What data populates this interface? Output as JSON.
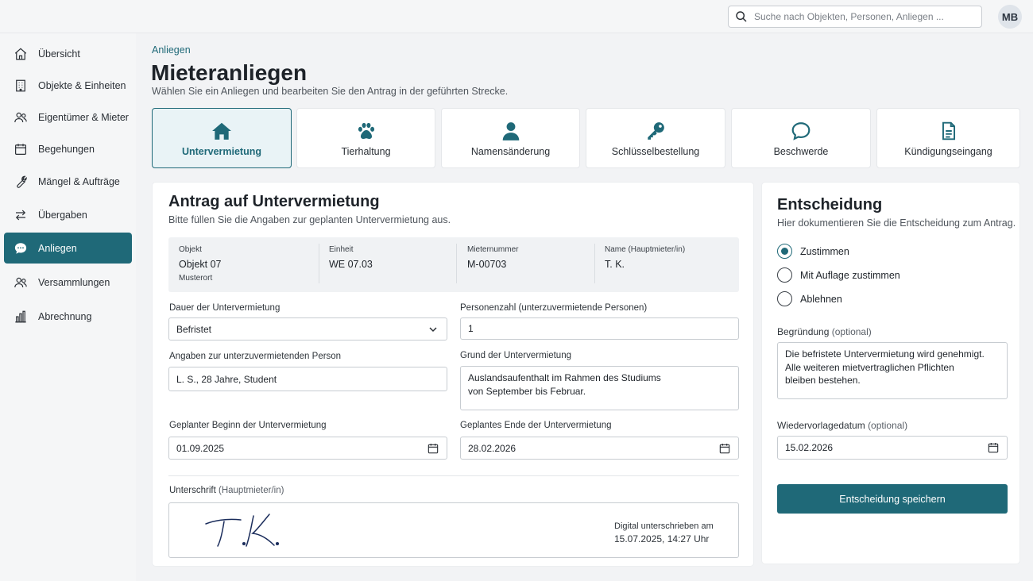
{
  "search": {
    "placeholder": "Suche nach Objekten, Personen, Anliegen ..."
  },
  "user": {
    "initials": "MB"
  },
  "sidebar": {
    "items": [
      {
        "label": "Übersicht",
        "icon": "home-icon"
      },
      {
        "label": "Objekte & Einheiten",
        "icon": "building-icon"
      },
      {
        "label": "Eigentümer & Mieter",
        "icon": "users-icon"
      },
      {
        "label": "Begehungen",
        "icon": "calendar-icon"
      },
      {
        "label": "Mängel & Aufträge",
        "icon": "wrench-icon"
      },
      {
        "label": "Übergaben",
        "icon": "swap-icon"
      },
      {
        "label": "Anliegen",
        "icon": "chat-icon",
        "active": true
      },
      {
        "label": "Versammlungen",
        "icon": "users-icon"
      },
      {
        "label": "Abrechnung",
        "icon": "bar-chart-icon"
      }
    ]
  },
  "header": {
    "breadcrumb": "Anliegen",
    "title": "Mieteranliegen",
    "subtitle": "Wählen Sie ein Anliegen und bearbeiten Sie den Antrag in der geführten Strecke."
  },
  "types": [
    {
      "label": "Untervermietung",
      "icon": "house-icon",
      "active": true
    },
    {
      "label": "Tierhaltung",
      "icon": "paw-icon"
    },
    {
      "label": "Namensänderung",
      "icon": "person-icon"
    },
    {
      "label": "Schlüsselbestellung",
      "icon": "key-icon"
    },
    {
      "label": "Beschwerde",
      "icon": "speech-bubble-icon"
    },
    {
      "label": "Kündigungseingang",
      "icon": "document-icon"
    }
  ],
  "form": {
    "title": "Antrag auf Untervermietung",
    "subtitle": "Bitte füllen Sie die Angaben zur geplanten Untervermietung aus.",
    "info": {
      "objekt_label": "Objekt",
      "objekt_value": "Objekt 07",
      "objekt_sub": "Musterort",
      "einheit_label": "Einheit",
      "einheit_value": "WE 07.03",
      "mieternummer_label": "Mieternummer",
      "mieternummer_value": "M-00703",
      "name_label": "Name (Hauptmieter/in)",
      "name_value": "T. K."
    },
    "dauer_label": "Dauer der Untervermietung",
    "dauer_value": "Befristet",
    "personen_label": "Personenzahl (unterzuvermietende Personen)",
    "personen_value": "1",
    "angaben_label": "Angaben zur unterzuvermietenden Person",
    "angaben_value": "L. S., 28 Jahre, Student",
    "grund_label": "Grund der Untervermietung",
    "grund_value": "Auslandsaufenthalt im Rahmen des Studiums\nvon September bis Februar.",
    "beginn_label": "Geplanter Beginn der Untervermietung",
    "beginn_value": "01.09.2025",
    "ende_label": "Geplantes Ende der Untervermietung",
    "ende_value": "28.02.2026",
    "unterschrift_label": "Unterschrift",
    "unterschrift_suffix": "(Hauptmieter/in)",
    "signature_line1": "Digital unterschrieben am",
    "signature_line2": "15.07.2025, 14:27 Uhr"
  },
  "decision": {
    "title": "Entscheidung",
    "subtitle": "Hier dokumentieren Sie die Entscheidung zum Antrag.",
    "options": [
      "Zustimmen",
      "Mit Auflage zustimmen",
      "Ablehnen"
    ],
    "selected_index": 0,
    "begruendung_label": "Begründung",
    "begruendung_optional": "(optional)",
    "begruendung_value": "Die befristete Untervermietung wird genehmigt.\nAlle weiteren mietvertraglichen Pflichten\nbleiben bestehen.",
    "wiedervorlage_label": "Wiedervorlagedatum",
    "wiedervorlage_optional": "(optional)",
    "wiedervorlage_value": "15.02.2026",
    "save_label": "Entscheidung speichern"
  },
  "colors": {
    "accent": "#1f6978",
    "active_card_bg": "#e9f3f6",
    "page_bg": "#f2f3f5"
  }
}
